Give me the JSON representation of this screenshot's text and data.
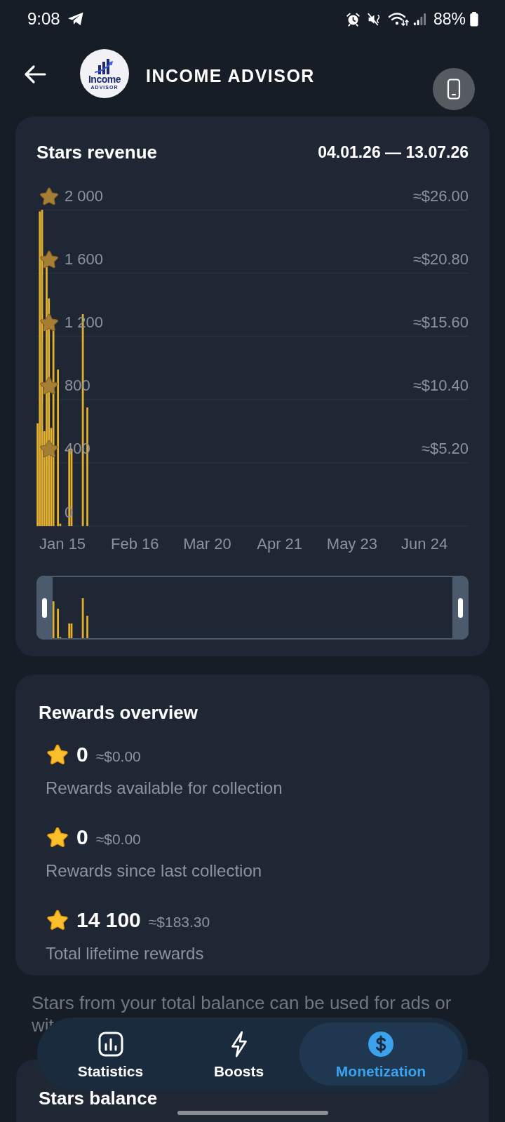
{
  "status_bar": {
    "time": "9:08",
    "battery": "88%"
  },
  "header": {
    "logo": {
      "title": "Income",
      "subtitle": "ADVISOR"
    },
    "title": "INCOME ADVISOR"
  },
  "revenue_card": {
    "title": "Stars revenue",
    "date_range": "04.01.26 — 13.07.26",
    "usd_labels": [
      "≈$26.00",
      "≈$20.80",
      "≈$15.60",
      "≈$10.40",
      "≈$5.20"
    ],
    "chart_data": {
      "type": "bar",
      "grid": true,
      "categories": [
        null,
        null,
        null,
        null,
        null,
        null,
        null,
        null,
        null,
        null,
        null,
        "Jan 15",
        null,
        null,
        null,
        null,
        null,
        null,
        null,
        null,
        null,
        null,
        null,
        null,
        null,
        null,
        null,
        null,
        null,
        null,
        null,
        null,
        null,
        null,
        null,
        null,
        null,
        null,
        null,
        null,
        null,
        null,
        null,
        "Feb 16",
        null,
        null,
        null,
        null,
        null,
        null,
        null,
        null,
        null,
        null,
        null,
        null,
        null,
        null,
        null,
        null,
        null,
        null,
        null,
        null,
        null,
        null,
        null,
        null,
        null,
        null,
        null,
        null,
        null,
        null,
        null,
        "Mar 20",
        null,
        null,
        null,
        null,
        null,
        null,
        null,
        null,
        null,
        null,
        null,
        null,
        null,
        null,
        null,
        null,
        null,
        null,
        null,
        null,
        null,
        null,
        null,
        null,
        null,
        null,
        null,
        null,
        null,
        null,
        null,
        "Apr 21",
        null,
        null,
        null,
        null,
        null,
        null,
        null,
        null,
        null,
        null,
        null,
        null,
        null,
        null,
        null,
        null,
        null,
        null,
        null,
        null,
        null,
        null,
        null,
        null,
        null,
        null,
        null,
        null,
        null,
        null,
        null,
        "May 23",
        null,
        null,
        null,
        null,
        null,
        null,
        null,
        null,
        null,
        null,
        null,
        null,
        null,
        null,
        null,
        null,
        null,
        null,
        null,
        null,
        null,
        null,
        null,
        null,
        null,
        null,
        null,
        null,
        null,
        null,
        null,
        "Jun 24",
        null,
        null,
        null,
        null,
        null,
        null,
        null,
        null,
        null,
        null,
        null,
        null,
        null,
        null,
        null,
        null,
        null,
        null,
        null
      ],
      "values": [
        650,
        1990,
        2000,
        600,
        1640,
        1440,
        620,
        1240,
        null,
        990,
        15,
        null,
        null,
        null,
        490,
        490,
        null,
        null,
        null,
        null,
        1340,
        null,
        750,
        null,
        null,
        null,
        null,
        null,
        null,
        null,
        null,
        null,
        null,
        null,
        null,
        null,
        null,
        null,
        null,
        null,
        null,
        null,
        null,
        null,
        null,
        null,
        null,
        null,
        null,
        null,
        null,
        null,
        null,
        null,
        null,
        null,
        null,
        null,
        null,
        null,
        null,
        null,
        null,
        null,
        null,
        null,
        null,
        null,
        null,
        null,
        null,
        null,
        null,
        null,
        null,
        null,
        null,
        null,
        null,
        null,
        null,
        null,
        null,
        null,
        null,
        null,
        null,
        null,
        null,
        null,
        null,
        null,
        null,
        null,
        null,
        null,
        null,
        null,
        null,
        null,
        null,
        null,
        null,
        null,
        null,
        null,
        null,
        null,
        null,
        null,
        null,
        null,
        null,
        null,
        null,
        null,
        null,
        null,
        null,
        null,
        null,
        null,
        null,
        null,
        null,
        null,
        null,
        null,
        null,
        null,
        null,
        null,
        null,
        null,
        null,
        null,
        null,
        null,
        null,
        null,
        null,
        null,
        null,
        null,
        null,
        null,
        null,
        null,
        null,
        null,
        null,
        null,
        null,
        null,
        null,
        null,
        null,
        null,
        null,
        null,
        null,
        null,
        null,
        null,
        null,
        null,
        null,
        null,
        null,
        null,
        null,
        null,
        null,
        null,
        null,
        null,
        null,
        null,
        null,
        null,
        null,
        null,
        null,
        null,
        null,
        null,
        null,
        null,
        null,
        null,
        null
      ],
      "ylim": [
        0,
        2000
      ],
      "yticks": [
        0,
        400,
        800,
        {
          "value": 1200,
          "label": "1 200"
        },
        {
          "value": 1600,
          "label": "1 600"
        },
        {
          "value": 2000,
          "label": "2 000"
        }
      ]
    }
  },
  "rewards_card": {
    "title": "Rewards overview",
    "items": [
      {
        "amount": "0",
        "usd": "≈$0.00",
        "label": "Rewards available for collection"
      },
      {
        "amount": "0",
        "usd": "≈$0.00",
        "label": "Rewards since last collection"
      },
      {
        "amount": "14 100",
        "usd": "≈$183.30",
        "label": "Total lifetime rewards"
      }
    ]
  },
  "balance_note": "Stars from your total balance can be used for ads or wit",
  "balance_card": {
    "title": "Stars balance"
  },
  "bottom_nav": {
    "tabs": [
      {
        "label": "Statistics",
        "selected": false
      },
      {
        "label": "Boosts",
        "selected": false
      },
      {
        "label": "Monetization",
        "selected": true
      }
    ]
  }
}
